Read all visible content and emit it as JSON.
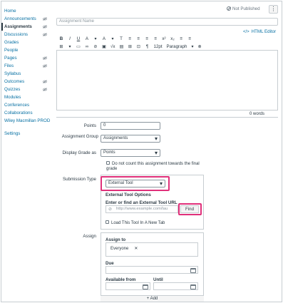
{
  "sidebar": {
    "items": [
      {
        "label": "Home",
        "eye": false
      },
      {
        "label": "Announcements",
        "eye": true
      },
      {
        "label": "Assignments",
        "eye": true,
        "active": true
      },
      {
        "label": "Discussions",
        "eye": true
      },
      {
        "label": "Grades",
        "eye": false
      },
      {
        "label": "People",
        "eye": false
      },
      {
        "label": "Pages",
        "eye": true
      },
      {
        "label": "Files",
        "eye": true
      },
      {
        "label": "Syllabus",
        "eye": false
      },
      {
        "label": "Outcomes",
        "eye": true
      },
      {
        "label": "Quizzes",
        "eye": true
      },
      {
        "label": "Modules",
        "eye": false
      },
      {
        "label": "Conferences",
        "eye": false
      },
      {
        "label": "Collaborations",
        "eye": false
      },
      {
        "label": "Wiley Macmillan PROD",
        "eye": false
      },
      {
        "label": "Settings",
        "eye": false
      }
    ]
  },
  "header": {
    "status": "Not Published",
    "kebab": "⋮"
  },
  "name_placeholder": "Assignment Name",
  "editor": {
    "html_editor": "HTML Editor",
    "toolbar_row1": [
      "B",
      "I",
      "U",
      "A",
      "▾",
      "A",
      "▾",
      "T",
      "≡",
      "≡",
      "≡",
      "≡",
      "x²",
      "x₂",
      "≡",
      "≡"
    ],
    "toolbar_row2": [
      "⊞",
      "▾",
      "▭",
      "∞",
      "⊘",
      "▣",
      "√x",
      "▤",
      "⊞",
      "⊡",
      "¶"
    ],
    "font_size": "12pt",
    "paragraph": "Paragraph",
    "words": "0 words"
  },
  "form": {
    "points_label": "Points",
    "points_value": "0",
    "group_label": "Assignment Group",
    "group_value": "Assignments",
    "display_label": "Display Grade as",
    "display_value": "Points",
    "no_count_label": "Do not count this assignment towards the final grade",
    "submission_label": "Submission Type",
    "submission_value": "External Tool",
    "ext_title": "External Tool Options",
    "ext_url_label": "Enter or find an External Tool URL",
    "ext_url_placeholder": "http://www.example.com/lau",
    "find_label": "Find",
    "new_tab_label": "Load This Tool In A New Tab",
    "assign_label": "Assign",
    "assign_to_label": "Assign to",
    "assign_tag": "Everyone",
    "due_label": "Due",
    "available_label": "Available from",
    "until_label": "Until",
    "add_label": "+ Add"
  },
  "colors": {
    "link": "#0770a3",
    "highlight": "#e0307a",
    "border": "#c7cdd1"
  }
}
